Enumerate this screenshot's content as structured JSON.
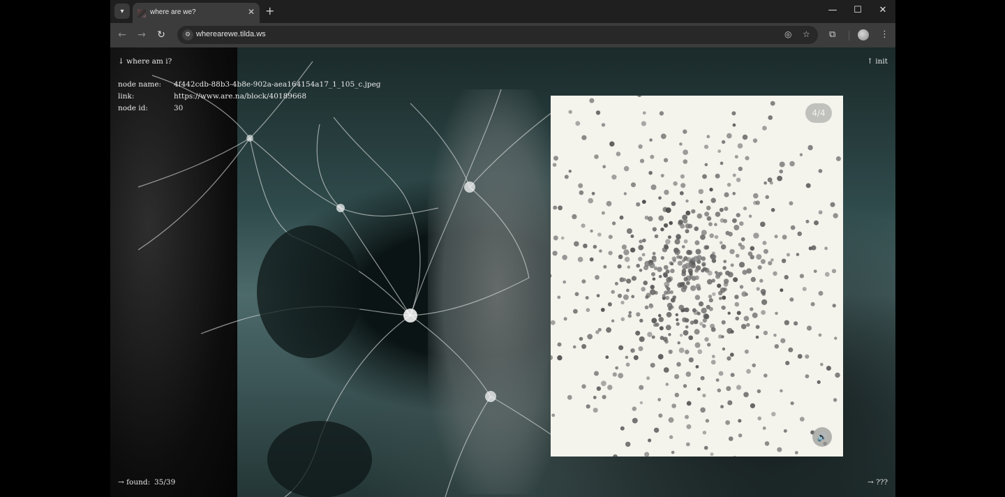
{
  "browser": {
    "tab_title": "where are we?",
    "url": "wherearewe.tilda.ws",
    "icons": {
      "tab_search": "chevron-down-icon",
      "close_tab": "close-icon",
      "new_tab": "plus-icon",
      "minimize": "minimize-icon",
      "maximize": "maximize-icon",
      "close_window": "close-icon",
      "back": "arrow-left-icon",
      "forward": "arrow-right-icon",
      "reload": "reload-icon",
      "site_info": "tune-icon",
      "eye_off": "eye-off-icon",
      "bookmark": "star-icon",
      "extensions": "puzzle-icon",
      "menu": "more-vertical-icon"
    }
  },
  "page": {
    "where_link": "↓ where am i?",
    "init_link": "↑ init",
    "info": {
      "name_label": "node name:",
      "name_value": "4f442cdb-88b3-4b8e-902a-aea164154a17_1_105_c.jpeg",
      "link_label": "link:",
      "link_value": "https://www.are.na/block/40189668",
      "id_label": "node id:",
      "id_value": "30"
    },
    "found_label": "→ found:",
    "found_value": "35/39",
    "unknown_link": "→ ???",
    "card": {
      "counter": "4/4",
      "sound_icon": "volume-icon"
    }
  }
}
